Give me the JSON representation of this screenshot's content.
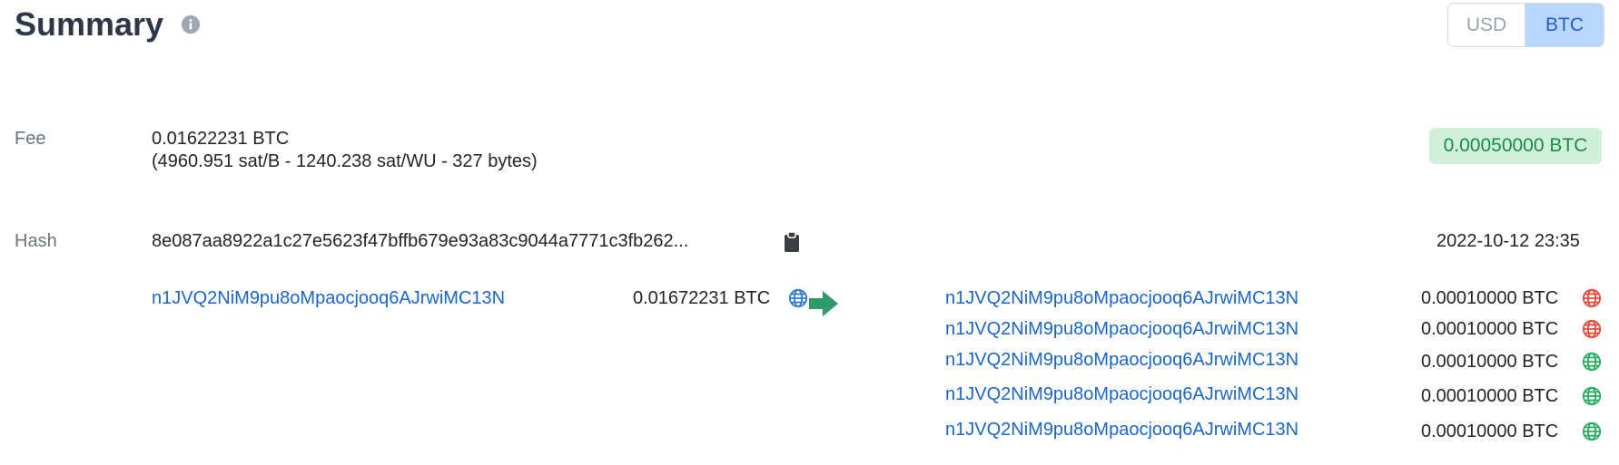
{
  "header": {
    "title": "Summary",
    "currency_toggle": {
      "usd_label": "USD",
      "btc_label": "BTC",
      "selected": "BTC"
    }
  },
  "fee": {
    "label": "Fee",
    "amount": "0.01622231 BTC",
    "details": "(4960.951 sat/B - 1240.238 sat/WU - 327 bytes)",
    "badge": "0.00050000 BTC"
  },
  "hash": {
    "label": "Hash",
    "value": "8e087aa8922a1c27e5623f47bffb679e93a83c9044a7771c3fb262...",
    "timestamp": "2022-10-12 23:35"
  },
  "inputs": [
    {
      "address": "n1JVQ2NiM9pu8oMpaocjooq6AJrwiMC13N",
      "amount": "0.01672231 BTC",
      "icon": "globe-icon",
      "icon_color": "#2d7bd9"
    }
  ],
  "outputs": [
    {
      "address": "n1JVQ2NiM9pu8oMpaocjooq6AJrwiMC13N",
      "amount": "0.00010000 BTC",
      "icon": "globe-icon",
      "icon_color": "#e74c3c"
    },
    {
      "address": "n1JVQ2NiM9pu8oMpaocjooq6AJrwiMC13N",
      "amount": "0.00010000 BTC",
      "icon": "globe-icon",
      "icon_color": "#e74c3c"
    },
    {
      "address": "n1JVQ2NiM9pu8oMpaocjooq6AJrwiMC13N",
      "amount": "0.00010000 BTC",
      "icon": "globe-icon",
      "icon_color": "#27ae60"
    },
    {
      "address": "n1JVQ2NiM9pu8oMpaocjooq6AJrwiMC13N",
      "amount": "0.00010000 BTC",
      "icon": "globe-icon",
      "icon_color": "#27ae60"
    },
    {
      "address": "n1JVQ2NiM9pu8oMpaocjooq6AJrwiMC13N",
      "amount": "0.00010000 BTC",
      "icon": "globe-icon",
      "icon_color": "#27ae60"
    }
  ],
  "colors": {
    "arrow": "#2e9a6a",
    "badge_bg": "#d1f0d9",
    "badge_text": "#1a8a4a",
    "link": "#1b66c9"
  }
}
